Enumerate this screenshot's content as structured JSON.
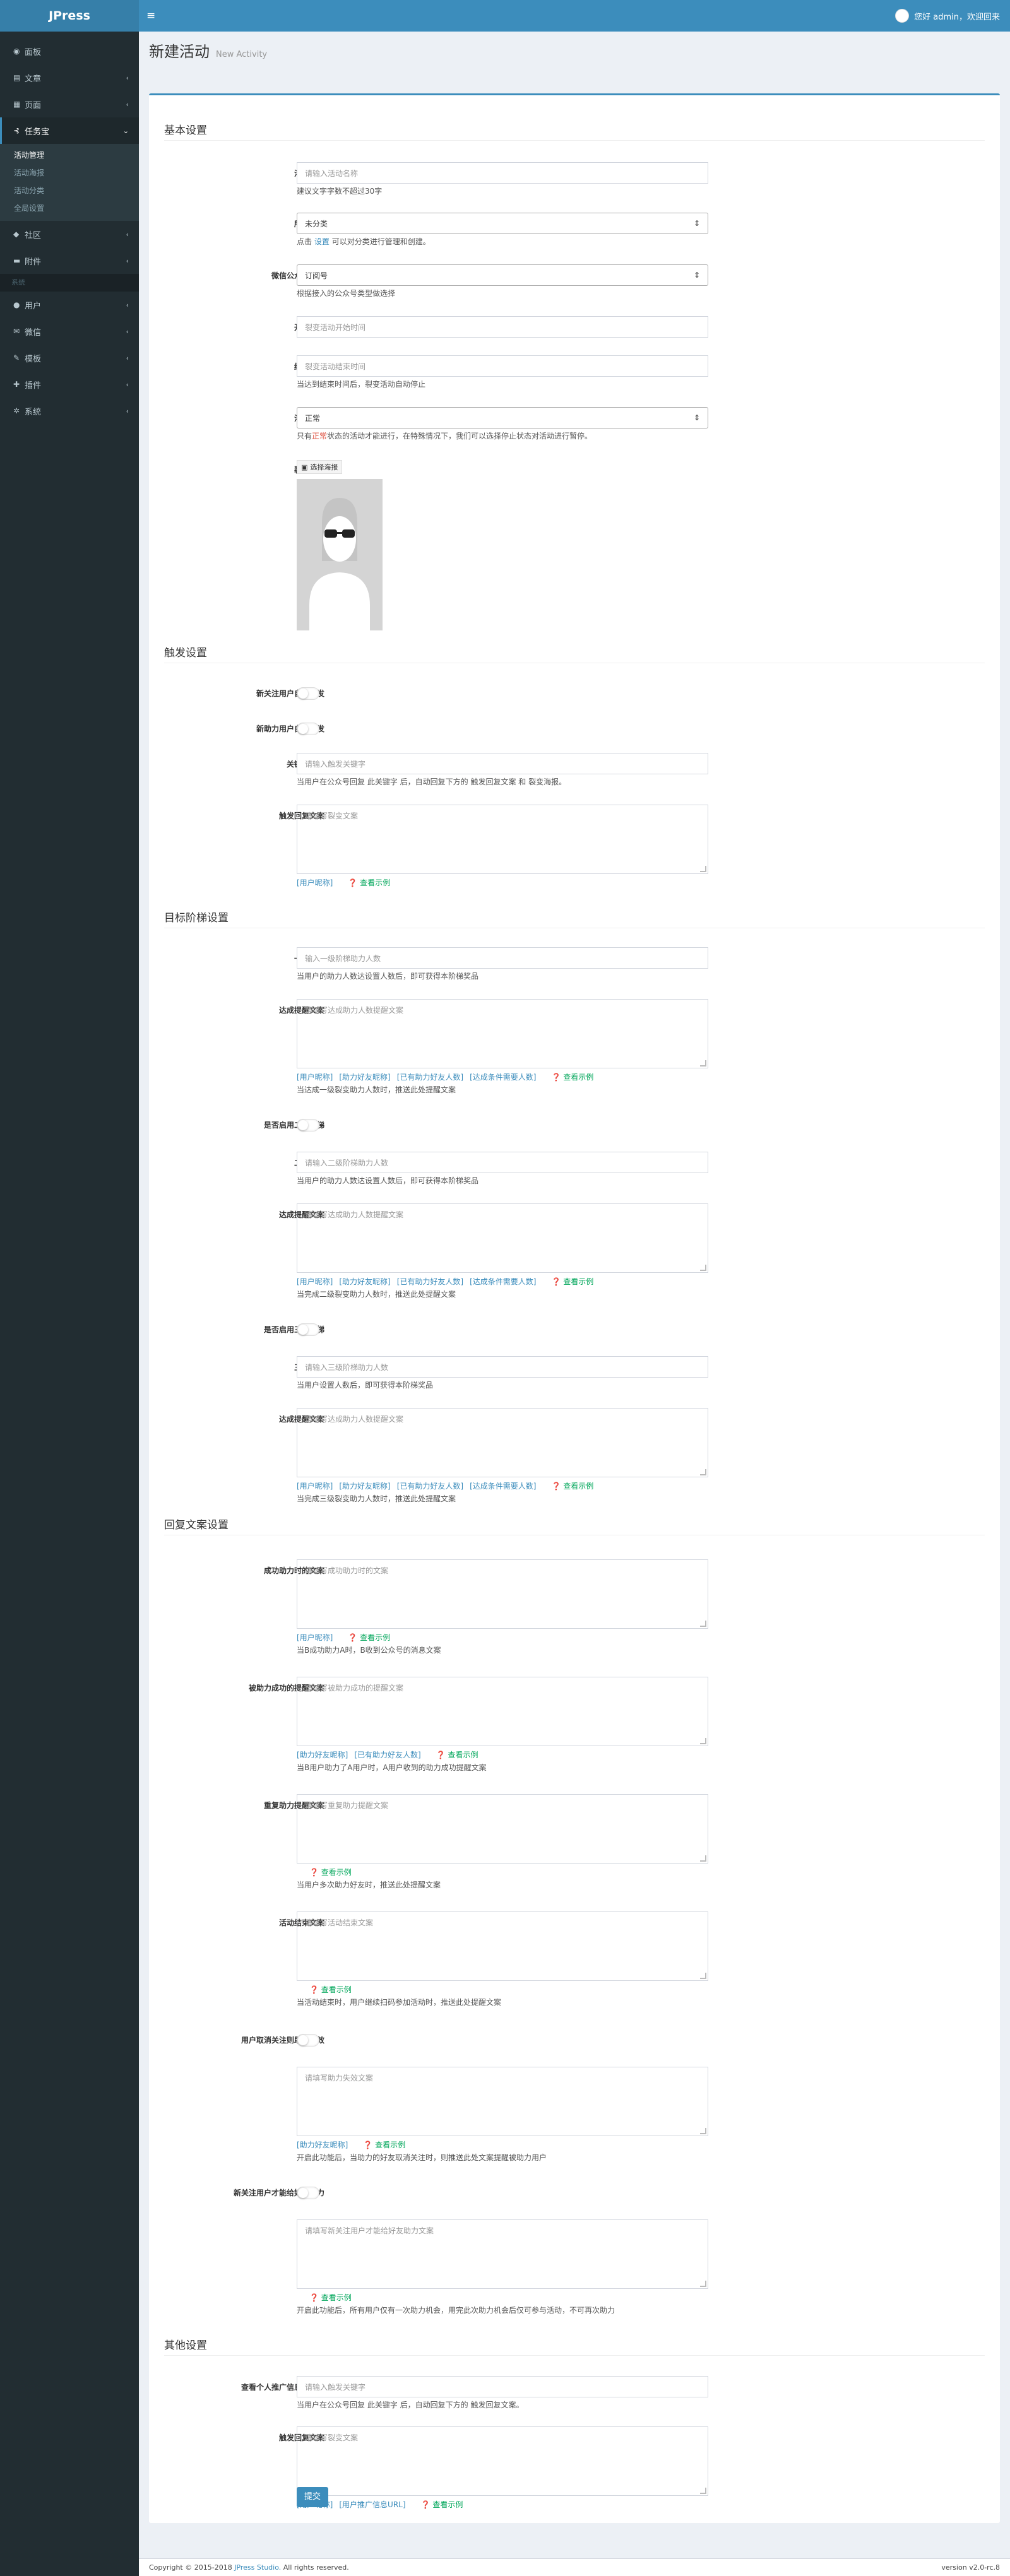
{
  "app": {
    "logo": "JPress",
    "user": "您好 admin，欢迎回来",
    "toggle_glyph": "≡"
  },
  "sidebar": {
    "items": [
      {
        "icon": "dashboard-icon",
        "glyph": "◉",
        "label": "面板"
      },
      {
        "icon": "file-icon",
        "glyph": "▤",
        "label": "文章"
      },
      {
        "icon": "page-icon",
        "glyph": "▦",
        "label": "页面"
      },
      {
        "icon": "share-icon",
        "glyph": "⊰",
        "label": "任务宝"
      }
    ],
    "task_sub": [
      "活动管理",
      "活动海报",
      "活动分类",
      "全局设置"
    ],
    "items2": [
      {
        "icon": "community-icon",
        "glyph": "◆",
        "label": "社区"
      },
      {
        "icon": "folder-icon",
        "glyph": "▬",
        "label": "附件"
      }
    ],
    "header_label": "系统",
    "items3": [
      {
        "icon": "user-icon",
        "glyph": "●",
        "label": "用户"
      },
      {
        "icon": "wechat-icon",
        "glyph": "✉",
        "label": "微信"
      },
      {
        "icon": "brush-icon",
        "glyph": "✎",
        "label": "模板"
      },
      {
        "icon": "plugin-icon",
        "glyph": "✚",
        "label": "插件"
      },
      {
        "icon": "gear-icon",
        "glyph": "✲",
        "label": "系统"
      }
    ]
  },
  "page": {
    "title": "新建活动",
    "subtitle": "New Activity"
  },
  "sections": {
    "basic": "基本设置",
    "trigger": "触发设置",
    "target": "目标阶梯设置",
    "reply": "回复文案设置",
    "other": "其他设置"
  },
  "basic": {
    "name_label": "活动名称",
    "name_placeholder": "请输入活动名称",
    "name_help": "建议文字字数不超过30字",
    "category_label": "所属类别",
    "category_value": "未分类",
    "category_help_pre": "点击",
    "category_help_link": "设置",
    "category_help_post": "可以对分类进行管理和创建。",
    "account_label": "微信公众号类型",
    "account_value": "订阅号",
    "account_help": "根据接入的公众号类型做选择",
    "start_label": "开始时间",
    "start_placeholder": "裂变活动开始时间",
    "end_label": "结束时间",
    "end_placeholder": "裂变活动结束时间",
    "end_help": "当达到结束时间后，裂变活动自动停止",
    "status_label": "活动状态",
    "status_value": "正常",
    "status_help_pre": "只有",
    "status_help_red": "正常",
    "status_help_post": "状态的活动才能进行，在特殊情况下，我们可以选择停止状态对活动进行暂停。",
    "poster_label": "裂变海报",
    "poster_button": "选择海报"
  },
  "trigger": {
    "new_follow_label": "新关注用户自动触发",
    "new_help_label": "新助力用户自动触发",
    "keyword_label": "关键字触发",
    "keyword_placeholder": "请输入触发关键字",
    "keyword_help": "当用户在公众号回复 此关键字 后，自动回复下方的 触发回复文案 和 裂变海报。",
    "reply_label": "触发回复文案",
    "reply_placeholder": "请填写裂变文案",
    "reply_link": "[用户昵称]",
    "example": "查看示例"
  },
  "target": {
    "l1_label": "一级阶梯",
    "l1_placeholder": "输入一级阶梯助力人数",
    "l1_help": "当用户的助力人数达设置人数后，即可获得本阶梯奖品",
    "msg_label": "达成提醒文案",
    "msg_placeholder": "请填写达成助力人数提醒文案",
    "tags": [
      "[用户昵称]",
      "[助力好友昵称]",
      "[已有助力好友人数]",
      "[达成条件需要人数]"
    ],
    "l1_msg_help": "当达成一级裂变助力人数时，推送此处提醒文案",
    "enable2_label": "是否启用二级阶梯",
    "l2_label": "二级阶梯",
    "l2_placeholder": "请输入二级阶梯助力人数",
    "l2_help": "当用户的助力人数达设置人数后，即可获得本阶梯奖品",
    "l2_msg_help": "当完成二级裂变助力人数时，推送此处提醒文案",
    "enable3_label": "是否启用三级阶梯",
    "l3_label": "三级阶梯",
    "l3_placeholder": "请输入三级阶梯助力人数",
    "l3_help": "当用户设置人数后，即可获得本阶梯奖品",
    "l3_msg_help": "当完成三级裂变助力人数时，推送此处提醒文案"
  },
  "reply": {
    "success_label": "成功助力时的文案",
    "success_placeholder": "请填写成功助力时的文案",
    "success_tags": [
      "[用户昵称]"
    ],
    "success_help": "当B成功助力A时，B收到公众号的消息文案",
    "helped_label": "被助力成功的提醒文案",
    "helped_placeholder": "请填写被助力成功的提醒文案",
    "helped_tags": [
      "[助力好友昵称]",
      "[已有助力好友人数]"
    ],
    "helped_help": "当B用户助力了A用户时，A用户收到的助力成功提醒文案",
    "repeat_label": "重复助力提醒文案",
    "repeat_placeholder": "请填写重复助力提醒文案",
    "repeat_help": "当用户多次助力好友时，推送此处提醒文案",
    "ended_label": "活动结束文案",
    "ended_placeholder": "请填写活动结束文案",
    "ended_help": "当活动结束时，用户继续扫码参加活动时，推送此处提醒文案",
    "unfollow_label": "用户取消关注则助力失效",
    "unfollow_placeholder": "请填写助力失效文案",
    "unfollow_tags": [
      "[助力好友昵称]"
    ],
    "unfollow_help": "开启此功能后，当助力的好友取消关注时，则推送此处文案提醒被助力用户",
    "newonly_label": "新关注用户才能给好友助力",
    "newonly_placeholder": "请填写新关注用户才能给好友助力文案",
    "newonly_help": "开启此功能后，所有用户仅有一次助力机会，用完此次助力机会后仅可参与活动，不可再次助力",
    "example": "查看示例"
  },
  "other": {
    "keyword_label": "查看个人推广信息关键字",
    "keyword_placeholder": "请输入触发关键字",
    "keyword_help": "当用户在公众号回复 此关键字 后，自动回复下方的 触发回复文案。",
    "reply_label": "触发回复文案",
    "reply_placeholder": "请填写裂变文案",
    "tags": [
      "[用户昵称]",
      "[用户推广信息URL]"
    ],
    "example": "查看示例",
    "submit": "提交"
  },
  "footer": {
    "copyright": "Copyright © 2015-2018",
    "studio": "JPress Studio.",
    "rights": "All rights reserved.",
    "version": "version v2.0-rc.8"
  }
}
